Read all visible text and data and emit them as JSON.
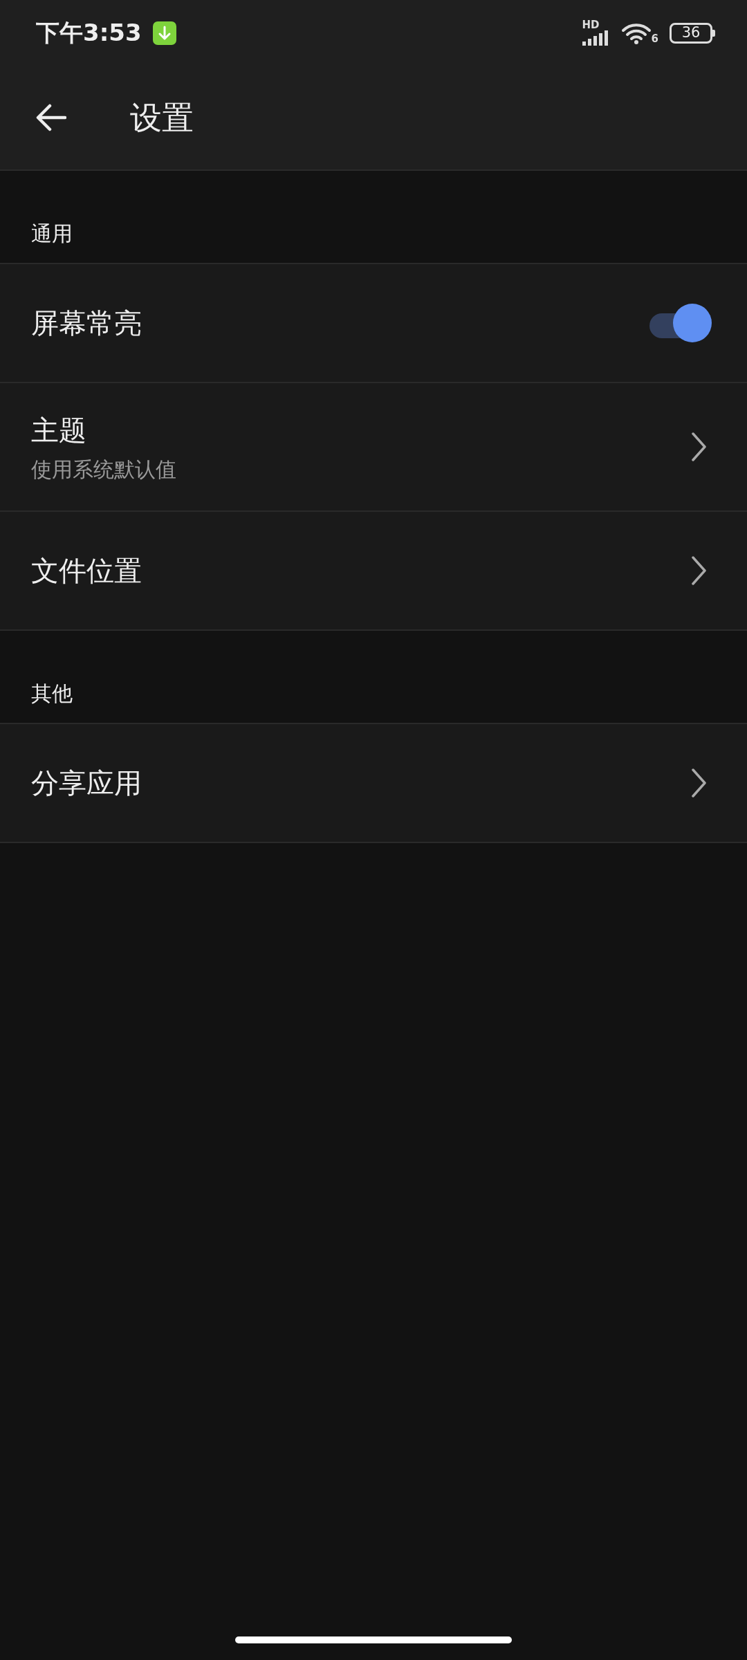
{
  "status_bar": {
    "time": "下午3:53",
    "network": "HD",
    "wifi_badge": "6",
    "battery": "36"
  },
  "app_bar": {
    "title": "设置"
  },
  "sections": [
    {
      "header": "通用",
      "items": [
        {
          "kind": "toggle",
          "title": "屏幕常亮",
          "on": true
        },
        {
          "kind": "link",
          "title": "主题",
          "subtitle": "使用系统默认值"
        },
        {
          "kind": "link",
          "title": "文件位置"
        }
      ]
    },
    {
      "header": "其他",
      "items": [
        {
          "kind": "link",
          "title": "分享应用"
        }
      ]
    }
  ]
}
